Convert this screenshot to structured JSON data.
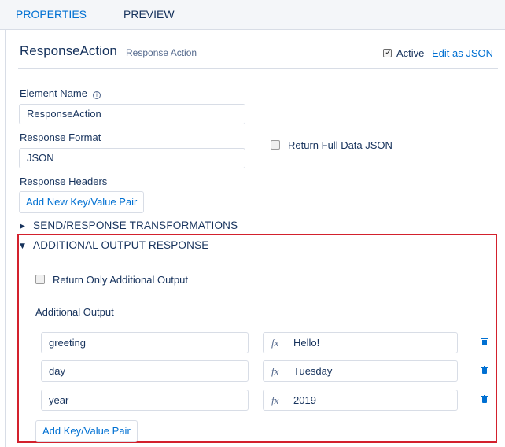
{
  "tabs": [
    {
      "label": "PROPERTIES",
      "active": true
    },
    {
      "label": "PREVIEW",
      "active": false
    }
  ],
  "header": {
    "title": "ResponseAction",
    "subtitle": "Response Action",
    "active_label": "Active",
    "active_checked": true,
    "edit_json_label": "Edit as JSON"
  },
  "form": {
    "element_name_label": "Element Name",
    "element_name_value": "ResponseAction",
    "response_format_label": "Response Format",
    "response_format_value": "JSON",
    "return_full_data_label": "Return Full Data JSON",
    "return_full_data_checked": false,
    "response_headers_label": "Response Headers",
    "add_new_pair_label": "Add New Key/Value Pair"
  },
  "sections": {
    "send_response_label": "SEND/RESPONSE TRANSFORMATIONS",
    "send_response_expanded": false,
    "additional_output_label": "ADDITIONAL OUTPUT RESPONSE",
    "additional_output_expanded": true
  },
  "additional": {
    "return_only_label": "Return Only Additional Output",
    "return_only_checked": false,
    "output_label": "Additional Output",
    "fx_symbol": "fx",
    "rows": [
      {
        "key": "greeting",
        "value": "Hello!"
      },
      {
        "key": "day",
        "value": "Tuesday"
      },
      {
        "key": "year",
        "value": "2019"
      }
    ],
    "add_pair_label": "Add Key/Value Pair"
  },
  "colors": {
    "accent": "#0070d2",
    "highlight_border": "#d3212d",
    "text": "#16325c"
  }
}
